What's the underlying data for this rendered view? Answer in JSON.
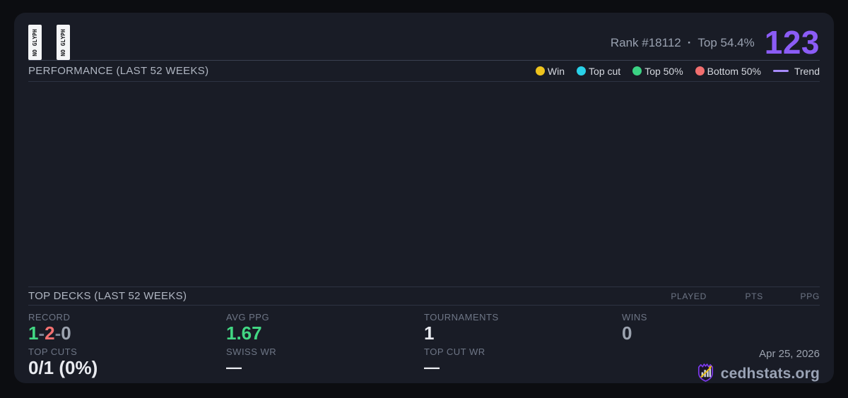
{
  "header": {
    "glyph_badges": [
      "NO GLYPH",
      "NO GLYPH"
    ],
    "rank_label": "Rank #18112",
    "separator": "·",
    "top_percent": "Top 54.4%",
    "points": "123"
  },
  "performance": {
    "title": "PERFORMANCE (LAST 52 WEEKS)",
    "legend": [
      {
        "label": "Win",
        "color": "#eec31d",
        "marker": "dot"
      },
      {
        "label": "Top cut",
        "color": "#29d1e8",
        "marker": "dot"
      },
      {
        "label": "Top 50%",
        "color": "#3bd283",
        "marker": "dot"
      },
      {
        "label": "Bottom 50%",
        "color": "#f26f6f",
        "marker": "dot"
      },
      {
        "label": "Trend",
        "color": "#a78bfa",
        "marker": "line"
      }
    ]
  },
  "top_decks": {
    "title": "TOP DECKS (LAST 52 WEEKS)",
    "columns": [
      "PLAYED",
      "PTS",
      "PPG"
    ],
    "rows": []
  },
  "stats": {
    "record": {
      "label": "RECORD",
      "wins": "1",
      "losses": "2",
      "draws": "0",
      "separator": "-"
    },
    "avg_ppg": {
      "label": "AVG PPG",
      "value": "1.67"
    },
    "tournaments": {
      "label": "TOURNAMENTS",
      "value": "1"
    },
    "wins": {
      "label": "WINS",
      "value": "0"
    },
    "top_cuts": {
      "label": "TOP CUTS",
      "value": "0/1 (0%)"
    },
    "swiss_wr": {
      "label": "SWISS WR",
      "value": "—"
    },
    "top_cut_wr": {
      "label": "TOP CUT WR",
      "value": "—"
    }
  },
  "footer": {
    "date": "Apr 25, 2026",
    "brand": "cedhstats.org"
  },
  "colors": {
    "accent_purple": "#8b5cf6",
    "win_green": "#42d783",
    "loss_red": "#f47171",
    "muted_gray": "#9ca3af",
    "card_background": "#191c26",
    "page_background": "#0c0d11"
  }
}
